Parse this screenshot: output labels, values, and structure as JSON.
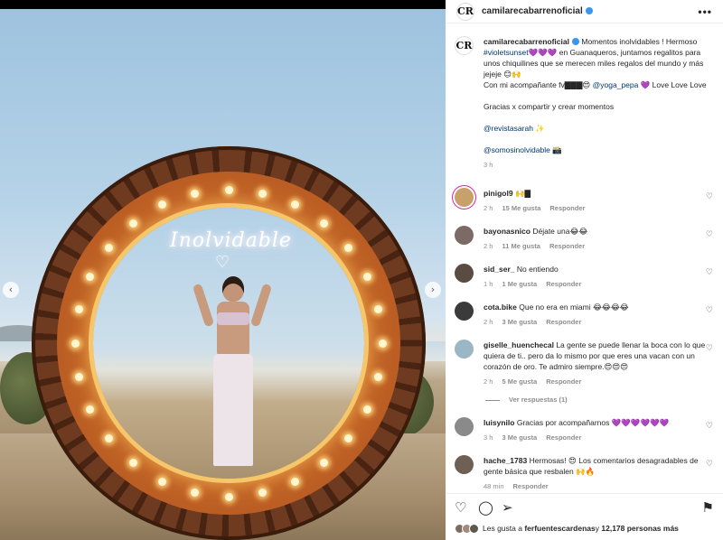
{
  "post": {
    "author": "camilarecabarreno",
    "logo_text": "CR",
    "neon_text": "Inolvidable"
  },
  "icons": {
    "verified": "verified-badge-icon",
    "more": "more-options-icon",
    "like": "heart-icon",
    "comment": "comment-icon",
    "share": "send-icon",
    "save": "bookmark-icon",
    "nav_prev": "chevron-left-icon",
    "nav_next": "chevron-right-icon"
  },
  "glyphs": {
    "more": "•••",
    "prev": "‹",
    "next": "›",
    "heart_small": "♡",
    "heart_neon": "♡",
    "like": "♡",
    "comment": "◯",
    "share": "➢",
    "save": "⚑"
  },
  "caption": {
    "username": "camilarecabarrenoficial",
    "lines": [
      "Momentos inolvidables ! Hermoso ",
      "#violetsunset",
      "💜💜💜 en Guanaqueros, juntamos regalitos para unos chiquilines que se merecen miles regalos del mundo y más jejeje 😊🙌",
      "Con mi acompañante fv▇▇▇😍 ",
      "@yoga_pepa",
      " 💜 Love Love Love",
      "Gracias x compartir y crear momentos",
      "@revistasarah",
      " ✨",
      "@somosinolvidable",
      " 📸"
    ],
    "time": "3 h"
  },
  "comments": [
    {
      "user": "pinigol9",
      "text": "🙌▇",
      "time": "2 h",
      "likes": "15 Me gusta",
      "reply": "Responder",
      "color": "#c7a06a"
    },
    {
      "user": "bayonasnico",
      "text": "Déjate una😂😂",
      "time": "2 h",
      "likes": "11 Me gusta",
      "reply": "Responder",
      "color": "#7b6a66"
    },
    {
      "user": "sid_ser_",
      "text": "No entiendo",
      "time": "1 h",
      "likes": "1 Me gusta",
      "reply": "Responder",
      "color": "#5a4b43"
    },
    {
      "user": "cota.bike",
      "text": "Que no era en miami 😂😂😂😂",
      "time": "2 h",
      "likes": "3 Me gusta",
      "reply": "Responder",
      "color": "#3b3b3b"
    },
    {
      "user": "giselle_huenchecal",
      "text": "La gente se puede llenar la boca con lo que quiera de ti.. pero da lo mismo por que eres una vacan con un corazón de oro. Te admiro siempre.😍😍😍",
      "time": "2 h",
      "likes": "5 Me gusta",
      "reply": "Responder",
      "color": "#9bb6c4"
    },
    {
      "user": "luisynilo",
      "text": "Gracias por acompañarnos 💜💜💜💜💜💜",
      "time": "3 h",
      "likes": "3 Me gusta",
      "reply": "Responder",
      "color": "#8a8a8a"
    },
    {
      "user": "hache_1783",
      "text": "Hermosas! 😍 Los comentarios desagradables de gente básica que resbalen 🙌🔥",
      "time": "48 min",
      "likes": "",
      "reply": "Responder",
      "color": "#6f6055"
    }
  ],
  "view_replies": "Ver respuestas (1)",
  "likes_line": {
    "prefix": "Les gusta a ",
    "user": "ferfuentescardenas",
    "middle": " y ",
    "count": "12,178 personas más"
  },
  "colors": {
    "verified": "#3897f0",
    "link": "#00376b",
    "muted": "#8e8e8e"
  }
}
